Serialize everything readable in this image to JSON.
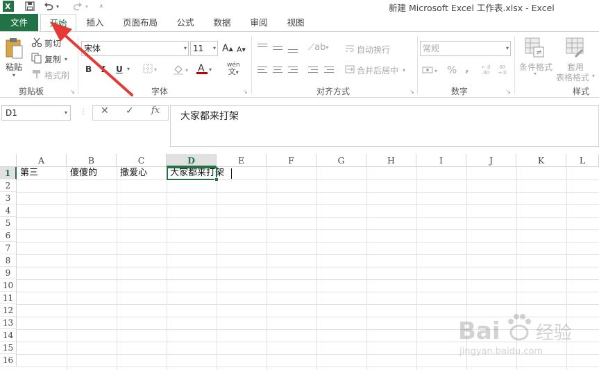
{
  "window": {
    "title": "新建 Microsoft Excel 工作表.xlsx - Excel"
  },
  "qat": {
    "excel_icon": "excel-logo-icon",
    "save_icon": "save-icon",
    "undo_icon": "undo-icon",
    "redo_icon": "redo-icon",
    "customize_icon": "customize-qat-icon"
  },
  "tabs": [
    {
      "label": "文件"
    },
    {
      "label": "开始"
    },
    {
      "label": "插入"
    },
    {
      "label": "页面布局"
    },
    {
      "label": "公式"
    },
    {
      "label": "数据"
    },
    {
      "label": "审阅"
    },
    {
      "label": "视图"
    }
  ],
  "ribbon": {
    "clipboard": {
      "paste": "粘贴",
      "cut": "剪切",
      "copy": "复制",
      "format_painter": "格式刷",
      "label": "剪贴板"
    },
    "font": {
      "name": "宋体",
      "size": "11",
      "bold": "B",
      "italic": "I",
      "underline": "U",
      "label": "字体",
      "font_color": "#c00000",
      "phonetic": "wén"
    },
    "alignment": {
      "wrap_text": "自动换行",
      "merge_center": "合并后居中",
      "label": "对齐方式"
    },
    "number": {
      "format": "常规",
      "percent": "%",
      "comma": ",",
      "inc_decimal": "←.0 .00",
      "dec_decimal": ".00 →.0",
      "label": "数字"
    },
    "styles": {
      "conditional": "条件格式",
      "table_line1": "套用",
      "table_line2": "表格格式",
      "label": "样式"
    }
  },
  "formula_bar": {
    "name_box": "D1",
    "cancel": "✕",
    "enter": "✓",
    "fx": "fx",
    "content": "大家都来打架"
  },
  "grid": {
    "columns": [
      "A",
      "B",
      "C",
      "D",
      "E",
      "F",
      "G",
      "H",
      "I",
      "J",
      "K",
      "L"
    ],
    "rows": [
      "1",
      "2",
      "3",
      "4",
      "5",
      "6",
      "7",
      "8",
      "9",
      "10",
      "11",
      "12",
      "13",
      "14",
      "15",
      "16"
    ],
    "row1": {
      "A": "第三",
      "B": "傻傻的",
      "C": "撒爱心",
      "D": "大家都来打架"
    },
    "selected_cell": "D1"
  },
  "watermark": {
    "brand": "Bai",
    "brand2": "经验",
    "url": "jingyan.baidu.com"
  },
  "colors": {
    "accent": "#217346",
    "arrow": "#e53935"
  }
}
